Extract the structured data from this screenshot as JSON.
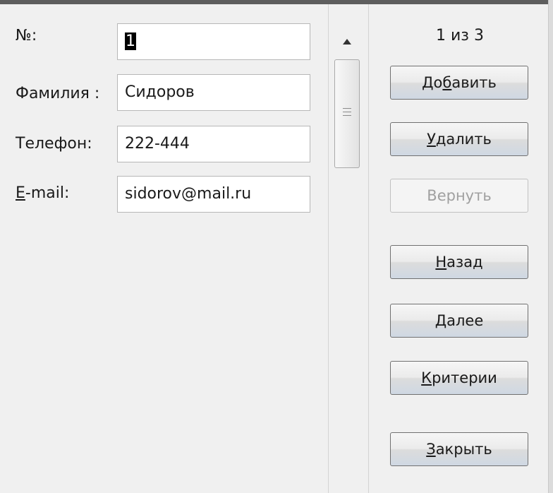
{
  "form": {
    "fields": [
      {
        "label": "№:",
        "value": "1"
      },
      {
        "label": "Фамилия :",
        "value": "Сидоров"
      },
      {
        "label": "Телефон:",
        "value": "222-444"
      },
      {
        "label": "E-mail:",
        "label_hotkey": "E",
        "label_rest": "-mail:",
        "value": "sidorov@mail.ru"
      }
    ]
  },
  "navigation": {
    "record_counter": "1 из 3"
  },
  "buttons": {
    "add": {
      "pre": "До",
      "hotkey": "б",
      "post": "авить",
      "label": "Добавить"
    },
    "delete": {
      "pre": "",
      "hotkey": "У",
      "post": "далить",
      "label": "Удалить"
    },
    "restore": {
      "label": "Вернуть",
      "enabled": false
    },
    "back": {
      "pre": "",
      "hotkey": "Н",
      "post": "азад",
      "label": "Назад"
    },
    "next": {
      "pre": "",
      "hotkey": "Д",
      "post": "алее",
      "label": "Далее"
    },
    "criteria": {
      "pre": "",
      "hotkey": "К",
      "post": "ритерии",
      "label": "Критерии"
    },
    "close": {
      "pre": "",
      "hotkey": "З",
      "post": "акрыть",
      "label": "Закрыть"
    }
  },
  "icons": {
    "scroll_up": "triangle-up-icon",
    "scroll_grip": "grip-lines-icon"
  },
  "colors": {
    "window_bg": "#f0f0f0",
    "button_border": "#707070",
    "disabled_text": "#a0a0a0"
  }
}
